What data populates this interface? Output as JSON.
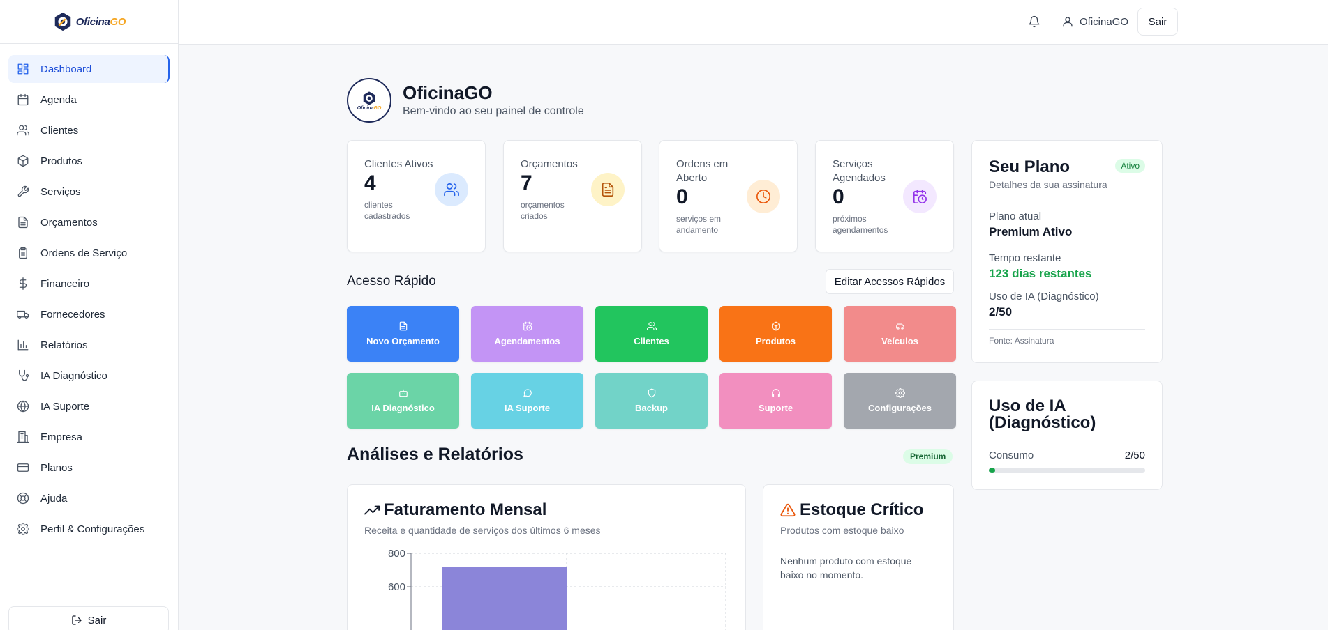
{
  "brand": {
    "name_part1": "Oficina",
    "name_part2": "GO"
  },
  "sidebar": {
    "items": [
      {
        "label": "Dashboard",
        "icon": "dashboard-icon",
        "active": true
      },
      {
        "label": "Agenda",
        "icon": "calendar-icon"
      },
      {
        "label": "Clientes",
        "icon": "users-icon"
      },
      {
        "label": "Produtos",
        "icon": "package-icon"
      },
      {
        "label": "Serviços",
        "icon": "wrench-icon"
      },
      {
        "label": "Orçamentos",
        "icon": "file-text-icon"
      },
      {
        "label": "Ordens de Serviço",
        "icon": "clipboard-icon"
      },
      {
        "label": "Financeiro",
        "icon": "dollar-icon"
      },
      {
        "label": "Fornecedores",
        "icon": "truck-icon"
      },
      {
        "label": "Relatórios",
        "icon": "bar-chart-icon"
      },
      {
        "label": "IA Diagnóstico",
        "icon": "stethoscope-icon"
      },
      {
        "label": "IA Suporte",
        "icon": "globe-icon"
      },
      {
        "label": "Empresa",
        "icon": "building-icon"
      },
      {
        "label": "Planos",
        "icon": "credit-card-icon"
      },
      {
        "label": "Ajuda",
        "icon": "life-buoy-icon"
      },
      {
        "label": "Perfil & Configurações",
        "icon": "settings-icon"
      }
    ],
    "logout_label": "Sair"
  },
  "topbar": {
    "user_name": "OficinaGO",
    "logout_label": "Sair"
  },
  "header": {
    "title": "OficinaGO",
    "subtitle": "Bem-vindo ao seu painel de controle"
  },
  "stats": [
    {
      "label": "Clientes Ativos",
      "value": "4",
      "sub": "clientes cadastrados",
      "color": "#2563eb",
      "bg": "#dbeafe"
    },
    {
      "label": "Orçamentos",
      "value": "7",
      "sub": "orçamentos criados",
      "color": "#b45309",
      "bg": "#fef3c7"
    },
    {
      "label": "Ordens em Aberto",
      "value": "0",
      "sub": "serviços em andamento",
      "color": "#ea580c",
      "bg": "#ffedd5"
    },
    {
      "label": "Serviços Agendados",
      "value": "0",
      "sub": "próximos agendamentos",
      "color": "#9333ea",
      "bg": "#f3e8ff"
    }
  ],
  "plan": {
    "title": "Seu Plano",
    "badge": "Ativo",
    "desc": "Detalhes da sua assinatura",
    "current_label": "Plano atual",
    "current_value": "Premium Ativo",
    "remaining_label": "Tempo restante",
    "remaining_value": "123 dias restantes",
    "ia_label": "Uso de IA (Diagnóstico)",
    "ia_value": "2/50",
    "source": "Fonte: Assinatura"
  },
  "ia_usage": {
    "title": "Uso de IA (Diagnóstico)",
    "label": "Consumo",
    "value": "2/50",
    "fraction": 0.04,
    "color": "#16a34a"
  },
  "quick_access": {
    "title": "Acesso Rápido",
    "edit_label": "Editar Acessos Rápidos",
    "tiles": [
      {
        "label": "Novo Orçamento",
        "color": "#3b82f6",
        "icon": "file-icon"
      },
      {
        "label": "Agendamentos",
        "color": "#c394f5",
        "icon": "calendar-clock-icon"
      },
      {
        "label": "Clientes",
        "color": "#22c55e",
        "icon": "users-icon"
      },
      {
        "label": "Produtos",
        "color": "#f97316",
        "icon": "package-icon"
      },
      {
        "label": "Veículos",
        "color": "#f28b8b",
        "icon": "car-icon"
      },
      {
        "label": "IA Diagnóstico",
        "color": "#6bd4a7",
        "icon": "bot-icon"
      },
      {
        "label": "IA Suporte",
        "color": "#67d2e4",
        "icon": "message-circle-icon"
      },
      {
        "label": "Backup",
        "color": "#72d3c8",
        "icon": "shield-icon"
      },
      {
        "label": "Suporte",
        "color": "#f28fbf",
        "icon": "headphones-icon"
      },
      {
        "label": "Configurações",
        "color": "#a3a7ae",
        "icon": "settings-icon"
      }
    ]
  },
  "analyses": {
    "title": "Análises e Relatórios",
    "badge": "Premium"
  },
  "revenue_card": {
    "title": "Faturamento Mensal",
    "subtitle": "Receita e quantidade de serviços dos últimos 6 meses"
  },
  "stock_card": {
    "title": "Estoque Crítico",
    "subtitle": "Produtos com estoque baixo",
    "message": "Nenhum produto com estoque baixo no momento."
  },
  "chart_data": {
    "type": "bar",
    "ytick_labels": [
      "800",
      "600"
    ],
    "ylim": [
      0,
      800
    ],
    "series": [
      {
        "values": [
          720
        ],
        "color": "#8b85d9"
      }
    ],
    "grid": true
  }
}
